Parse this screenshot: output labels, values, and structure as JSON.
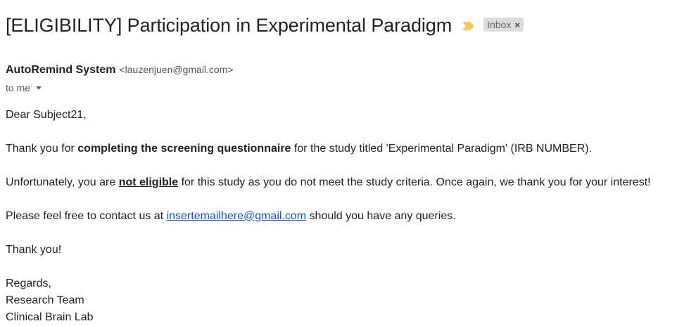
{
  "email": {
    "subject": "[ELIGIBILITY] Participation in Experimental Paradigm",
    "importance_marker_icon": "importance-marker-icon",
    "importance_color": "#f2c94c",
    "label": {
      "text": "Inbox",
      "close": "×"
    },
    "sender": {
      "name": "AutoRemind System",
      "email": "<lauzenjuen@gmail.com>"
    },
    "recipient": {
      "text": "to me",
      "icon": "chevron-down-icon"
    },
    "body": {
      "greeting": "Dear Subject21,",
      "p1_before": "Thank you for ",
      "p1_bold": "completing the screening questionnaire",
      "p1_after": " for the study titled 'Experimental Paradigm' (IRB NUMBER).",
      "p2_before": "Unfortunately, you are ",
      "p2_emphasis": "not eligible",
      "p2_after": " for this study as you do not meet the study criteria. Once again, we thank you for your interest!",
      "p3_before": "Please feel free to contact us at ",
      "p3_link": "insertemailhere@gmail.com",
      "p3_after": " should you have any queries.",
      "thanks": "Thank you!",
      "regards": "Regards,",
      "team": "Research Team",
      "lab": "Clinical Brain Lab"
    },
    "link_color": "#1155cc"
  }
}
